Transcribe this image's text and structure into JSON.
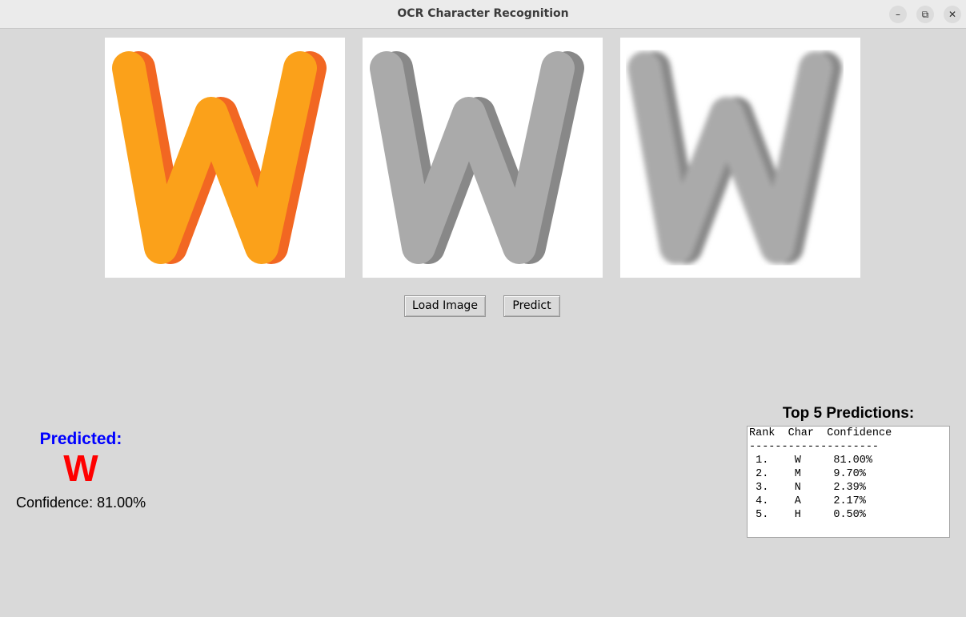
{
  "window": {
    "title": "OCR Character Recognition",
    "minimize_icon": "minimize-icon",
    "maximize_icon": "restore-icon",
    "close_icon": "close-icon"
  },
  "images": {
    "original": {
      "letter": "W",
      "fill_color": "#fba11a",
      "shade_color": "#f26722"
    },
    "grayscale": {
      "letter": "W",
      "fill_color": "#aaaaaa",
      "shade_color": "#888888"
    },
    "preprocessed": {
      "letter": "W",
      "fill_color": "#aaaaaa",
      "shade_color": "#888888"
    }
  },
  "buttons": {
    "load_label": "Load Image",
    "predict_label": "Predict"
  },
  "prediction": {
    "heading": "Predicted:",
    "character": "W",
    "confidence_text": "Confidence: 81.00%",
    "heading_color": "#0000ff",
    "character_color": "#ff0000"
  },
  "top5": {
    "title": "Top 5 Predictions:",
    "header": "Rank  Char  Confidence",
    "separator": "--------------------",
    "rows": [
      {
        "rank": "1.",
        "char": "W",
        "confidence": "81.00%"
      },
      {
        "rank": "2.",
        "char": "M",
        "confidence": "9.70%"
      },
      {
        "rank": "3.",
        "char": "N",
        "confidence": "2.39%"
      },
      {
        "rank": "4.",
        "char": "A",
        "confidence": "2.17%"
      },
      {
        "rank": "5.",
        "char": "H",
        "confidence": "0.50%"
      }
    ]
  }
}
